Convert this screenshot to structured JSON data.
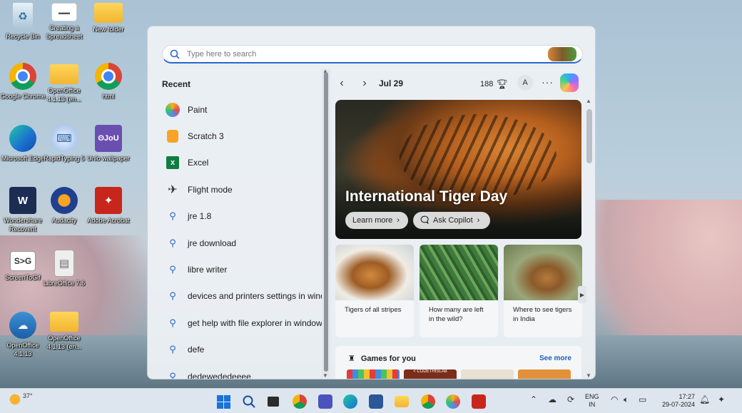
{
  "desktop": {
    "icons": [
      {
        "label": "Recycle Bin",
        "icon": "recycle-bin-icon",
        "glyph": "♻"
      },
      {
        "label": "Creating a Spreadsheet",
        "icon": "spreadsheet-file-icon",
        "glyph": "▬▬"
      },
      {
        "label": "New folder",
        "icon": "folder-icon",
        "glyph": ""
      },
      {
        "label": "Google Chrome",
        "icon": "chrome-icon",
        "glyph": ""
      },
      {
        "label": "OpenOffice 4.1.13 (en...",
        "icon": "folder-icon",
        "glyph": ""
      },
      {
        "label": "html",
        "icon": "chrome-icon",
        "glyph": ""
      },
      {
        "label": "Microsoft Edge",
        "icon": "edge-icon",
        "glyph": ""
      },
      {
        "label": "RapidTyping 5",
        "icon": "rapidtyping-icon",
        "glyph": "⌨"
      },
      {
        "label": "Unlo wallpaper",
        "icon": "wallpaper-app-icon",
        "glyph": "ʘJoU"
      },
      {
        "label": "Wondershare Recoverit",
        "icon": "recoverit-icon",
        "glyph": "W"
      },
      {
        "label": "Audacity",
        "icon": "audacity-icon",
        "glyph": ""
      },
      {
        "label": "Adobe Acrobat",
        "icon": "acrobat-icon",
        "glyph": "✦"
      },
      {
        "label": "ScreenToGif",
        "icon": "screentogif-icon",
        "glyph": "S>G"
      },
      {
        "label": "LibreOffice 7.6",
        "icon": "libreoffice-icon",
        "glyph": "▤"
      },
      {
        "label": "OpenOffice 4.1.13",
        "icon": "openoffice-icon",
        "glyph": "☁"
      },
      {
        "label": "OpenOffice 4.1.13 (en...",
        "icon": "folder-icon",
        "glyph": ""
      }
    ]
  },
  "search": {
    "placeholder": "Type here to search"
  },
  "recent": {
    "title": "Recent",
    "items": [
      {
        "label": "Paint",
        "icon": "paint-icon"
      },
      {
        "label": "Scratch 3",
        "icon": "scratch-icon"
      },
      {
        "label": "Excel",
        "icon": "excel-icon",
        "glyph": "x"
      },
      {
        "label": "Flight mode",
        "icon": "airplane-icon",
        "glyph": "✈"
      },
      {
        "label": "jre 1.8",
        "icon": "search-icon",
        "glyph": "⚲"
      },
      {
        "label": "jre download",
        "icon": "search-icon",
        "glyph": "⚲"
      },
      {
        "label": "libre writer",
        "icon": "search-icon",
        "glyph": "⚲"
      },
      {
        "label": "devices and printers settings in windc",
        "icon": "search-icon",
        "glyph": "⚲"
      },
      {
        "label": "get help with file explorer in windows",
        "icon": "search-icon",
        "glyph": "⚲"
      },
      {
        "label": "defe",
        "icon": "search-icon",
        "glyph": "⚲"
      },
      {
        "label": "dedewededeeee",
        "icon": "search-icon",
        "glyph": "⚲"
      }
    ]
  },
  "highlights": {
    "date": "Jul 29",
    "points": "188",
    "avatar_initial": "A",
    "more": "···",
    "hero": {
      "title": "International Tiger Day",
      "learn_more": "Learn more",
      "ask_copilot": "Ask Copilot"
    },
    "cards": [
      {
        "caption": "Tigers of all stripes"
      },
      {
        "caption": "How many are left in the wild?"
      },
      {
        "caption": "Where to see tigers in India"
      }
    ],
    "games": {
      "title": "Games for you",
      "see_more": "See more",
      "thumb2_text": "< CODETHISLAB"
    }
  },
  "taskbar": {
    "temperature": "37°",
    "lang_line1": "ENG",
    "lang_line2": "IN",
    "time": "17:27",
    "date": "29-07-2024"
  },
  "colors": {
    "accent": "#2b66c9",
    "see_more": "#1d5fb8"
  }
}
